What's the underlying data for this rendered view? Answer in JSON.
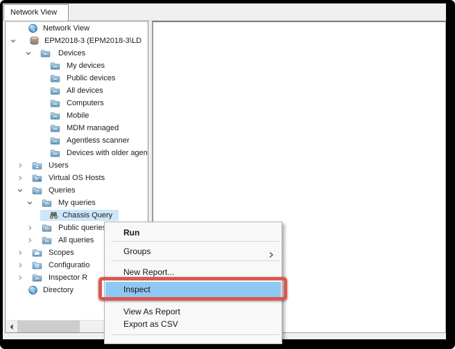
{
  "window": {
    "tab_label": "Network View"
  },
  "tree": {
    "selection_color": "#cbe7fa",
    "items": [
      {
        "label": "Network View",
        "icon": "globe",
        "level": "root"
      },
      {
        "label": "EPM2018-3 (EPM2018-3\\LD",
        "icon": "database",
        "level": "server",
        "chevron": "expanded"
      },
      {
        "label": "Devices",
        "icon": "folder-devices",
        "level": "devices",
        "chevron": "expanded"
      },
      {
        "label": "My devices",
        "icon": "folder-devices",
        "level": "devchild"
      },
      {
        "label": "Public devices",
        "icon": "folder-devices",
        "level": "devchild"
      },
      {
        "label": "All devices",
        "icon": "folder-devices",
        "level": "devchild"
      },
      {
        "label": "Computers",
        "icon": "folder-devices",
        "level": "devchild"
      },
      {
        "label": "Mobile",
        "icon": "folder-devices",
        "level": "devchild"
      },
      {
        "label": "MDM managed",
        "icon": "folder-devices",
        "level": "devchild"
      },
      {
        "label": "Agentless scanner",
        "icon": "folder-devices",
        "level": "devchild"
      },
      {
        "label": "Devices with older agent",
        "icon": "folder-devices",
        "level": "devchild"
      },
      {
        "label": "Users",
        "icon": "folder-users",
        "level": "section",
        "chevron": "collapsed"
      },
      {
        "label": "Virtual OS Hosts",
        "icon": "folder-vm",
        "level": "section",
        "chevron": "collapsed"
      },
      {
        "label": "Queries",
        "icon": "folder-query",
        "level": "section",
        "chevron": "expanded"
      },
      {
        "label": "My queries",
        "icon": "folder-query",
        "level": "qgroup",
        "chevron": "expanded"
      },
      {
        "label": "Chassis Query",
        "icon": "binoculars",
        "level": "qleaf",
        "selected": true
      },
      {
        "label": "Public queries",
        "icon": "folder-query",
        "level": "qgroup",
        "chevron": "collapsed"
      },
      {
        "label": "All queries",
        "icon": "folder-query",
        "level": "qgroup",
        "chevron": "collapsed"
      },
      {
        "label": "Scopes",
        "icon": "folder-cloud",
        "level": "section",
        "chevron": "collapsed"
      },
      {
        "label": "Configuratio",
        "icon": "folder-gear",
        "level": "section",
        "chevron": "collapsed"
      },
      {
        "label": "Inspector R",
        "icon": "folder-devices",
        "level": "section",
        "chevron": "collapsed"
      },
      {
        "label": "Directory",
        "icon": "globe",
        "level": "root"
      }
    ]
  },
  "context_menu": {
    "highlight_color": "#8fc8f2",
    "items": [
      {
        "type": "item",
        "label": "Run",
        "bold": true
      },
      {
        "type": "separator"
      },
      {
        "type": "item",
        "label": "Groups",
        "submenu": true
      },
      {
        "type": "separator"
      },
      {
        "type": "item",
        "label": "New Report..."
      },
      {
        "type": "item",
        "label": "Inspect",
        "highlighted": true
      },
      {
        "type": "item",
        "label": "View As Report"
      },
      {
        "type": "item",
        "label": "Export as CSV"
      },
      {
        "type": "separator"
      }
    ]
  },
  "annotation": {
    "type": "red-box",
    "target": "Inspect",
    "color": "#dc574e"
  }
}
